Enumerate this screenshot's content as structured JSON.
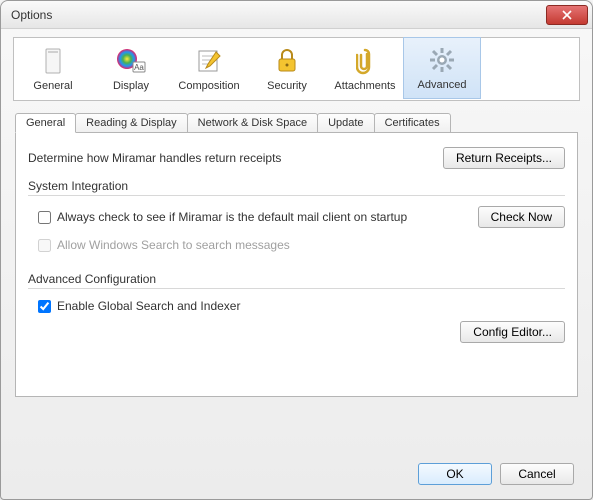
{
  "window": {
    "title": "Options"
  },
  "toolbar": {
    "items": [
      {
        "label": "General"
      },
      {
        "label": "Display"
      },
      {
        "label": "Composition"
      },
      {
        "label": "Security"
      },
      {
        "label": "Attachments"
      },
      {
        "label": "Advanced"
      }
    ],
    "selected": "Advanced"
  },
  "subtabs": {
    "items": [
      {
        "label": "General"
      },
      {
        "label": "Reading & Display"
      },
      {
        "label": "Network & Disk Space"
      },
      {
        "label": "Update"
      },
      {
        "label": "Certificates"
      }
    ],
    "active": "General"
  },
  "general": {
    "description": "Determine how Miramar handles return receipts",
    "return_receipts_btn": "Return Receipts...",
    "system_integration": {
      "title": "System Integration",
      "always_check": {
        "label": "Always check to see if Miramar is the default mail client on startup",
        "checked": false
      },
      "check_now_btn": "Check Now",
      "windows_search": {
        "label": "Allow Windows Search to search messages",
        "checked": false,
        "disabled": true
      }
    },
    "advanced_config": {
      "title": "Advanced Configuration",
      "global_search": {
        "label": "Enable Global Search and Indexer",
        "checked": true
      },
      "config_editor_btn": "Config Editor..."
    }
  },
  "footer": {
    "ok": "OK",
    "cancel": "Cancel"
  }
}
